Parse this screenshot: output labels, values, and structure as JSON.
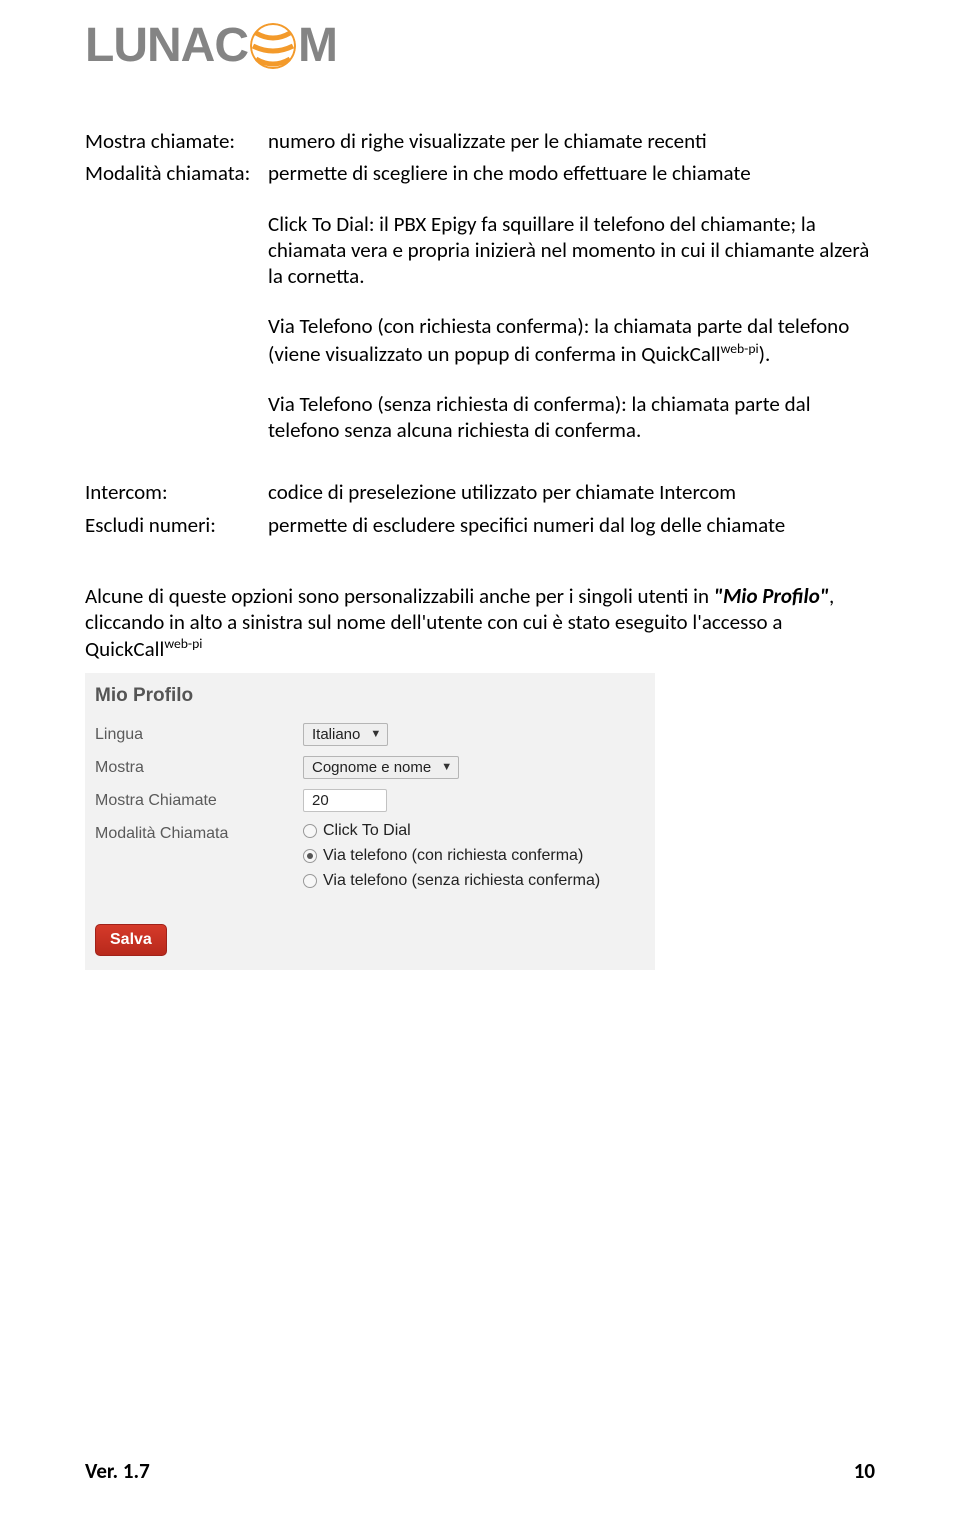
{
  "logo": {
    "part1": "LUNAC",
    "part2": "M"
  },
  "defs": {
    "row1": {
      "label": "Mostra chiamate:",
      "value": "numero di righe visualizzate per le chiamate recenti"
    },
    "row2": {
      "label": "Modalità chiamata:",
      "value": "permette di scegliere in che modo effettuare le chiamate"
    },
    "p1": "Click To Dial: il PBX Epigy fa squillare il telefono del chiamante; la chiamata vera e propria inizierà nel momento in cui il chiamante alzerà la cornetta.",
    "p2a": "Via Telefono (con richiesta conferma): la chiamata parte dal telefono (viene visualizzato un popup di conferma in QuickCall",
    "p2sup": "web-pi",
    "p2b": ").",
    "p3": "Via Telefono (senza richiesta di conferma): la chiamata parte dal telefono senza alcuna richiesta di conferma.",
    "row3": {
      "label": "Intercom:",
      "value": "codice di preselezione utilizzato per chiamate Intercom"
    },
    "row4": {
      "label": "Escludi numeri:",
      "value": "permette di escludere specifici numeri dal log delle chiamate"
    }
  },
  "para": {
    "t1": "Alcune di queste opzioni sono personalizzabili anche per i singoli utenti in ",
    "mio": "\"Mio Profilo\"",
    "t2": ", cliccando in alto a sinistra sul nome dell'utente con cui è stato eseguito l'accesso a QuickCall",
    "sup": "web-pi"
  },
  "profile": {
    "title": "Mio Profilo",
    "rows": {
      "lingua": {
        "label": "Lingua",
        "value": "Italiano"
      },
      "mostra": {
        "label": "Mostra",
        "value": "Cognome e nome"
      },
      "mostra_chiamate": {
        "label": "Mostra Chiamate",
        "value": "20"
      },
      "modalita": {
        "label": "Modalità Chiamata",
        "opt1": "Click To Dial",
        "opt2": "Via telefono (con richiesta conferma)",
        "opt3": "Via telefono (senza richiesta conferma)"
      }
    },
    "save": "Salva"
  },
  "footer": {
    "ver": "Ver. 1.7",
    "page": "10"
  }
}
